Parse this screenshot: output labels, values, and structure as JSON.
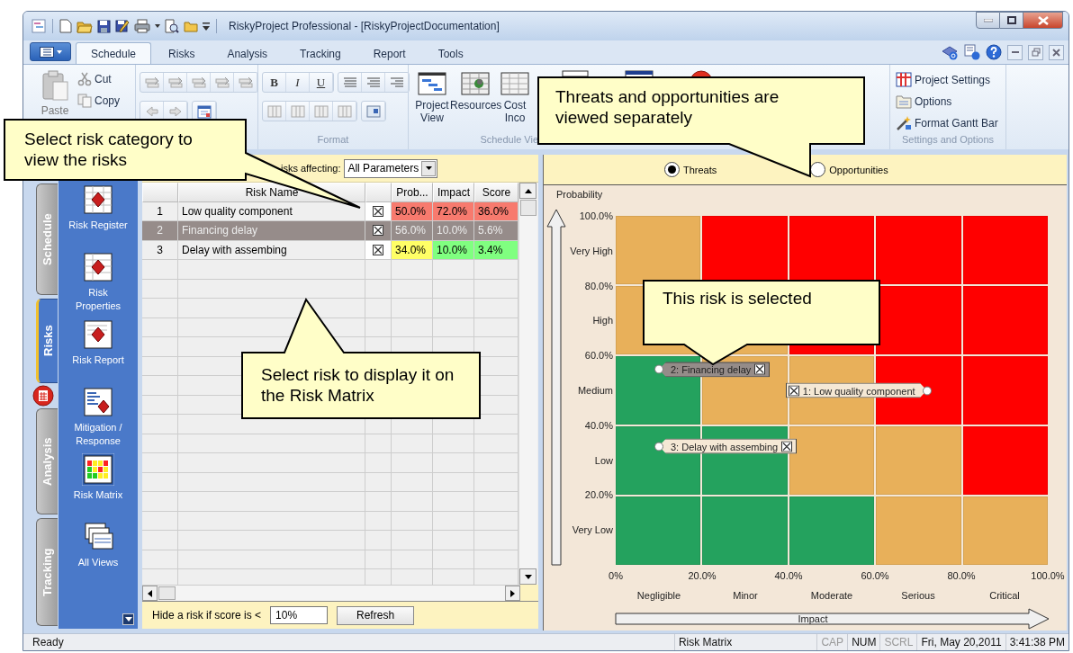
{
  "window": {
    "title": "RiskyProject Professional - [RiskyProjectDocumentation]"
  },
  "ribbon": {
    "tabs": [
      {
        "label": "Schedule",
        "selected": true
      },
      {
        "label": "Risks",
        "selected": false
      },
      {
        "label": "Analysis",
        "selected": false
      },
      {
        "label": "Tracking",
        "selected": false
      },
      {
        "label": "Report",
        "selected": false
      },
      {
        "label": "Tools",
        "selected": false
      }
    ],
    "clipboard": {
      "paste": "Paste",
      "cut": "Cut",
      "copy": "Copy"
    },
    "format": {
      "buttons": [
        "B",
        "I",
        "U"
      ],
      "label": "Format"
    },
    "schedule_views": {
      "buttons": [
        "Project View",
        "Resources",
        "Cost Inco"
      ],
      "label": "Schedule Vie"
    },
    "settings": {
      "buttons": [
        "Project Settings",
        "Options",
        "Format Gantt Bar"
      ],
      "label": "Settings and Options"
    }
  },
  "side_tabs": [
    {
      "label": "Schedule",
      "selected": false
    },
    {
      "label": "Risks",
      "selected": true
    },
    {
      "label": "Analysis",
      "selected": false
    },
    {
      "label": "Tracking",
      "selected": false
    }
  ],
  "sidebar": {
    "items": [
      {
        "label": "Risk Register",
        "selected": false
      },
      {
        "label": "Risk Properties",
        "selected": false
      },
      {
        "label": "Risk Report",
        "selected": false
      },
      {
        "label": "Mitigation / Response",
        "selected": false
      },
      {
        "label": "Risk Matrix",
        "selected": true
      },
      {
        "label": "All Views",
        "selected": false
      }
    ]
  },
  "risks": {
    "filter_label": "isks affecting:",
    "filter_value": "All Parameters",
    "columns": [
      "Risk Name",
      "Prob...",
      "Impact",
      "Score"
    ],
    "rows": [
      {
        "number": "1",
        "name": "Low quality component",
        "checked": true,
        "selected": false,
        "probability": {
          "text": "50.0%",
          "color": "#f77a6e"
        },
        "impact": {
          "text": "72.0%",
          "color": "#f77a6e"
        },
        "score": {
          "text": "36.0%",
          "color": "#f77a6e"
        }
      },
      {
        "number": "2",
        "name": "Financing delay",
        "checked": true,
        "selected": true,
        "probability": {
          "text": "56.0%"
        },
        "impact": {
          "text": "10.0%"
        },
        "score": {
          "text": "5.6%"
        }
      },
      {
        "number": "3",
        "name": "Delay with assembing",
        "checked": true,
        "selected": false,
        "probability": {
          "text": "34.0%",
          "color": "#ffff66"
        },
        "impact": {
          "text": "10.0%",
          "color": "#80ff80"
        },
        "score": {
          "text": "3.4%",
          "color": "#80ff80"
        }
      }
    ],
    "hide_label": "Hide a risk if score is <",
    "hide_value": "10%",
    "refresh": "Refresh"
  },
  "matrix": {
    "options": [
      {
        "label": "Threats",
        "selected": true
      },
      {
        "label": "Opportunities",
        "selected": false
      }
    ],
    "y_title": "Probability",
    "x_title": "Impact",
    "y_ticks": [
      "100.0%",
      "80.0%",
      "60.0%",
      "40.0%",
      "20.0%"
    ],
    "y_levels": [
      "Very High",
      "High",
      "Medium",
      "Low",
      "Very Low"
    ],
    "x_ticks": [
      "0%",
      "20.0%",
      "40.0%",
      "60.0%",
      "80.0%",
      "100.0%"
    ],
    "x_levels": [
      "Negligible",
      "Minor",
      "Moderate",
      "Serious",
      "Critical"
    ],
    "grid": [
      {
        "cells": [
          {
            "color": "#e8b05a"
          },
          {
            "color": "#ff0000"
          },
          {
            "color": "#ff0000"
          },
          {
            "color": "#ff0000"
          },
          {
            "color": "#ff0000"
          }
        ]
      },
      {
        "cells": [
          {
            "color": "#e8b05a"
          },
          {
            "color": "#e8b05a"
          },
          {
            "color": "#ff0000"
          },
          {
            "color": "#ff0000"
          },
          {
            "color": "#ff0000"
          }
        ]
      },
      {
        "cells": [
          {
            "color": "#24a25e"
          },
          {
            "color": "#e8b05a"
          },
          {
            "color": "#e8b05a"
          },
          {
            "color": "#ff0000"
          },
          {
            "color": "#ff0000"
          }
        ]
      },
      {
        "cells": [
          {
            "color": "#24a25e"
          },
          {
            "color": "#24a25e"
          },
          {
            "color": "#e8b05a"
          },
          {
            "color": "#e8b05a"
          },
          {
            "color": "#ff0000"
          }
        ]
      },
      {
        "cells": [
          {
            "color": "#24a25e"
          },
          {
            "color": "#24a25e"
          },
          {
            "color": "#24a25e"
          },
          {
            "color": "#e8b05a"
          },
          {
            "color": "#e8b05a"
          }
        ]
      }
    ],
    "markers": [
      {
        "label": "1: Low quality component",
        "checked": true,
        "selected": false,
        "kind": "left"
      },
      {
        "label": "2: Financing delay",
        "checked": true,
        "selected": true,
        "kind": "right"
      },
      {
        "label": "3: Delay with assembing",
        "checked": true,
        "selected": false,
        "kind": "right"
      }
    ]
  },
  "status_bar": {
    "message": "Ready",
    "view": "Risk Matrix",
    "indicators": [
      {
        "label": "CAP",
        "on": false
      },
      {
        "label": "NUM",
        "on": true
      },
      {
        "label": "SCRL",
        "on": false
      }
    ],
    "date": "Fri, May 20,2011",
    "time": "3:41:38 PM"
  },
  "callouts": [
    {
      "text": "Select risk category to view the risks"
    },
    {
      "text": "Threats and opportunities are viewed separately"
    },
    {
      "text": "Select risk to display it on the Risk Matrix"
    },
    {
      "text": "This risk is selected"
    }
  ]
}
